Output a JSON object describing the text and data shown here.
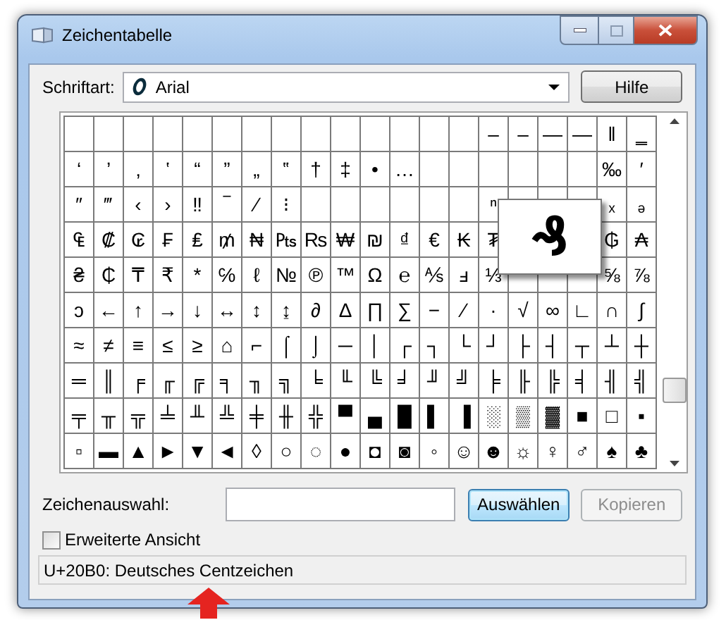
{
  "window": {
    "title": "Zeichentabelle"
  },
  "font": {
    "label": "Schriftart:",
    "value": "Arial"
  },
  "help_button": "Hilfe",
  "grid": {
    "rows": [
      [
        null,
        null,
        null,
        null,
        null,
        null,
        null,
        null,
        null,
        null,
        null,
        null,
        null,
        null,
        "‒",
        "–",
        "—",
        "―",
        "‖",
        "‗"
      ],
      [
        "‘",
        "’",
        "‚",
        "‛",
        "“",
        "”",
        "„",
        "‟",
        "†",
        "‡",
        "•",
        "…",
        null,
        null,
        null,
        null,
        null,
        null,
        "‰",
        "′"
      ],
      [
        "″",
        "‴",
        "‹",
        "›",
        "‼",
        "‾",
        "⁄",
        "⁝",
        null,
        null,
        null,
        null,
        null,
        null,
        "ⁿ",
        null,
        null,
        null,
        "ₓ",
        "ₔ"
      ],
      [
        "₠",
        "₡",
        "₢",
        "₣",
        "₤",
        "₥",
        "₦",
        "₧",
        "₨",
        "₩",
        "₪",
        "₫",
        "€",
        "₭",
        "₮",
        null,
        null,
        null,
        "₲",
        "₳"
      ],
      [
        "₴",
        "₵",
        "₸",
        "₹",
        "*",
        "℅",
        "ℓ",
        "№",
        "℗",
        "™",
        "Ω",
        "℮",
        "⅍",
        "ⅎ",
        "⅓",
        null,
        null,
        null,
        "⅝",
        "⅞"
      ],
      [
        "ↄ",
        "←",
        "↑",
        "→",
        "↓",
        "↔",
        "↕",
        "↨",
        "∂",
        "∆",
        "∏",
        "∑",
        "−",
        "∕",
        "∙",
        "√",
        "∞",
        "∟",
        "∩",
        "∫"
      ],
      [
        "≈",
        "≠",
        "≡",
        "≤",
        "≥",
        "⌂",
        "⌐",
        "⌠",
        "⌡",
        "─",
        "│",
        "┌",
        "┐",
        "└",
        "┘",
        "├",
        "┤",
        "┬",
        "┴",
        "┼"
      ],
      [
        "═",
        "║",
        "╒",
        "╓",
        "╔",
        "╕",
        "╖",
        "╗",
        "╘",
        "╙",
        "╚",
        "╛",
        "╜",
        "╝",
        "╞",
        "╟",
        "╠",
        "╡",
        "╢",
        "╣"
      ],
      [
        "╤",
        "╥",
        "╦",
        "╧",
        "╨",
        "╩",
        "╪",
        "╫",
        "╬",
        "▀",
        "▄",
        "█",
        "▌",
        "▐",
        "░",
        "▒",
        "▓",
        "■",
        "□",
        "▪"
      ],
      [
        "▫",
        "▬",
        "▲",
        "►",
        "▼",
        "◄",
        "◊",
        "○",
        "◌",
        "●",
        "◘",
        "◙",
        "◦",
        "☺",
        "☻",
        "☼",
        "♀",
        "♂",
        "♠",
        "♣"
      ]
    ]
  },
  "magnifier": {
    "char": "₰"
  },
  "selection": {
    "label": "Zeichenauswahl:"
  },
  "select_button": "Auswählen",
  "copy_button": {
    "label": "Kopieren",
    "disabled": true
  },
  "advanced_view": {
    "label": "Erweiterte Ansicht",
    "checked": false
  },
  "status_bar": "U+20B0: Deutsches Centzeichen"
}
